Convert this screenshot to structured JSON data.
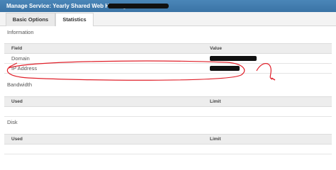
{
  "header": {
    "title": "Manage Service: Yearly Shared Web Hosting -"
  },
  "tabs": [
    {
      "label": "Basic Options"
    },
    {
      "label": "Statistics"
    }
  ],
  "information": {
    "title": "Information",
    "columns": {
      "field": "Field",
      "value": "Value"
    },
    "rows": [
      {
        "field": "Domain"
      },
      {
        "field": "IP Address"
      }
    ]
  },
  "bandwidth": {
    "title": "Bandwidth",
    "columns": {
      "used": "Used",
      "limit": "Limit"
    }
  },
  "disk": {
    "title": "Disk",
    "columns": {
      "used": "Used",
      "limit": "Limit"
    }
  },
  "annotation_color": "#e0202a"
}
